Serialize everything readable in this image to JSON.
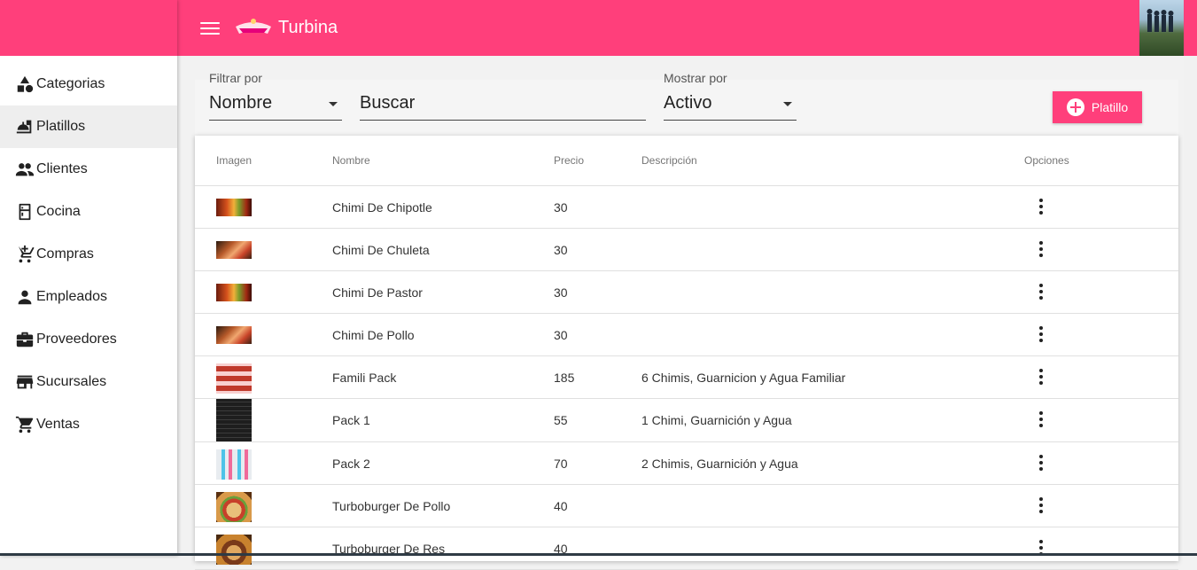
{
  "app": {
    "title": "Turbina"
  },
  "colors": {
    "primary": "#ff3f7b"
  },
  "sidebar": {
    "items": [
      {
        "label": "Categorias",
        "icon": "shapes-icon"
      },
      {
        "label": "Platillos",
        "icon": "dinner-icon"
      },
      {
        "label": "Clientes",
        "icon": "people-icon"
      },
      {
        "label": "Cocina",
        "icon": "kitchen-icon"
      },
      {
        "label": "Compras",
        "icon": "add-cart-icon"
      },
      {
        "label": "Empleados",
        "icon": "person-icon"
      },
      {
        "label": "Proveedores",
        "icon": "briefcase-icon"
      },
      {
        "label": "Sucursales",
        "icon": "store-icon"
      },
      {
        "label": "Ventas",
        "icon": "cart-icon"
      }
    ]
  },
  "filters": {
    "filter_label": "Filtrar por",
    "filter_value": "Nombre",
    "search_placeholder": "Buscar",
    "show_label": "Mostrar por",
    "show_value": "Activo",
    "add_label": "Platillo"
  },
  "table": {
    "headers": {
      "image": "Imagen",
      "name": "Nombre",
      "price": "Precio",
      "description": "Descripción",
      "options": "Opciones"
    },
    "rows": [
      {
        "name": "Chimi De Chipotle",
        "price": "30",
        "description": ""
      },
      {
        "name": "Chimi De Chuleta",
        "price": "30",
        "description": ""
      },
      {
        "name": "Chimi De Pastor",
        "price": "30",
        "description": ""
      },
      {
        "name": "Chimi De Pollo",
        "price": "30",
        "description": ""
      },
      {
        "name": "Famili Pack",
        "price": "185",
        "description": "6 Chimis, Guarnicion y Agua Familiar"
      },
      {
        "name": "Pack 1",
        "price": "55",
        "description": "1 Chimi, Guarnición y Agua"
      },
      {
        "name": "Pack 2",
        "price": "70",
        "description": "2 Chimis, Guarnición y Agua"
      },
      {
        "name": "Turboburger De Pollo",
        "price": "40",
        "description": ""
      },
      {
        "name": "Turboburger De Res",
        "price": "40",
        "description": ""
      }
    ]
  }
}
